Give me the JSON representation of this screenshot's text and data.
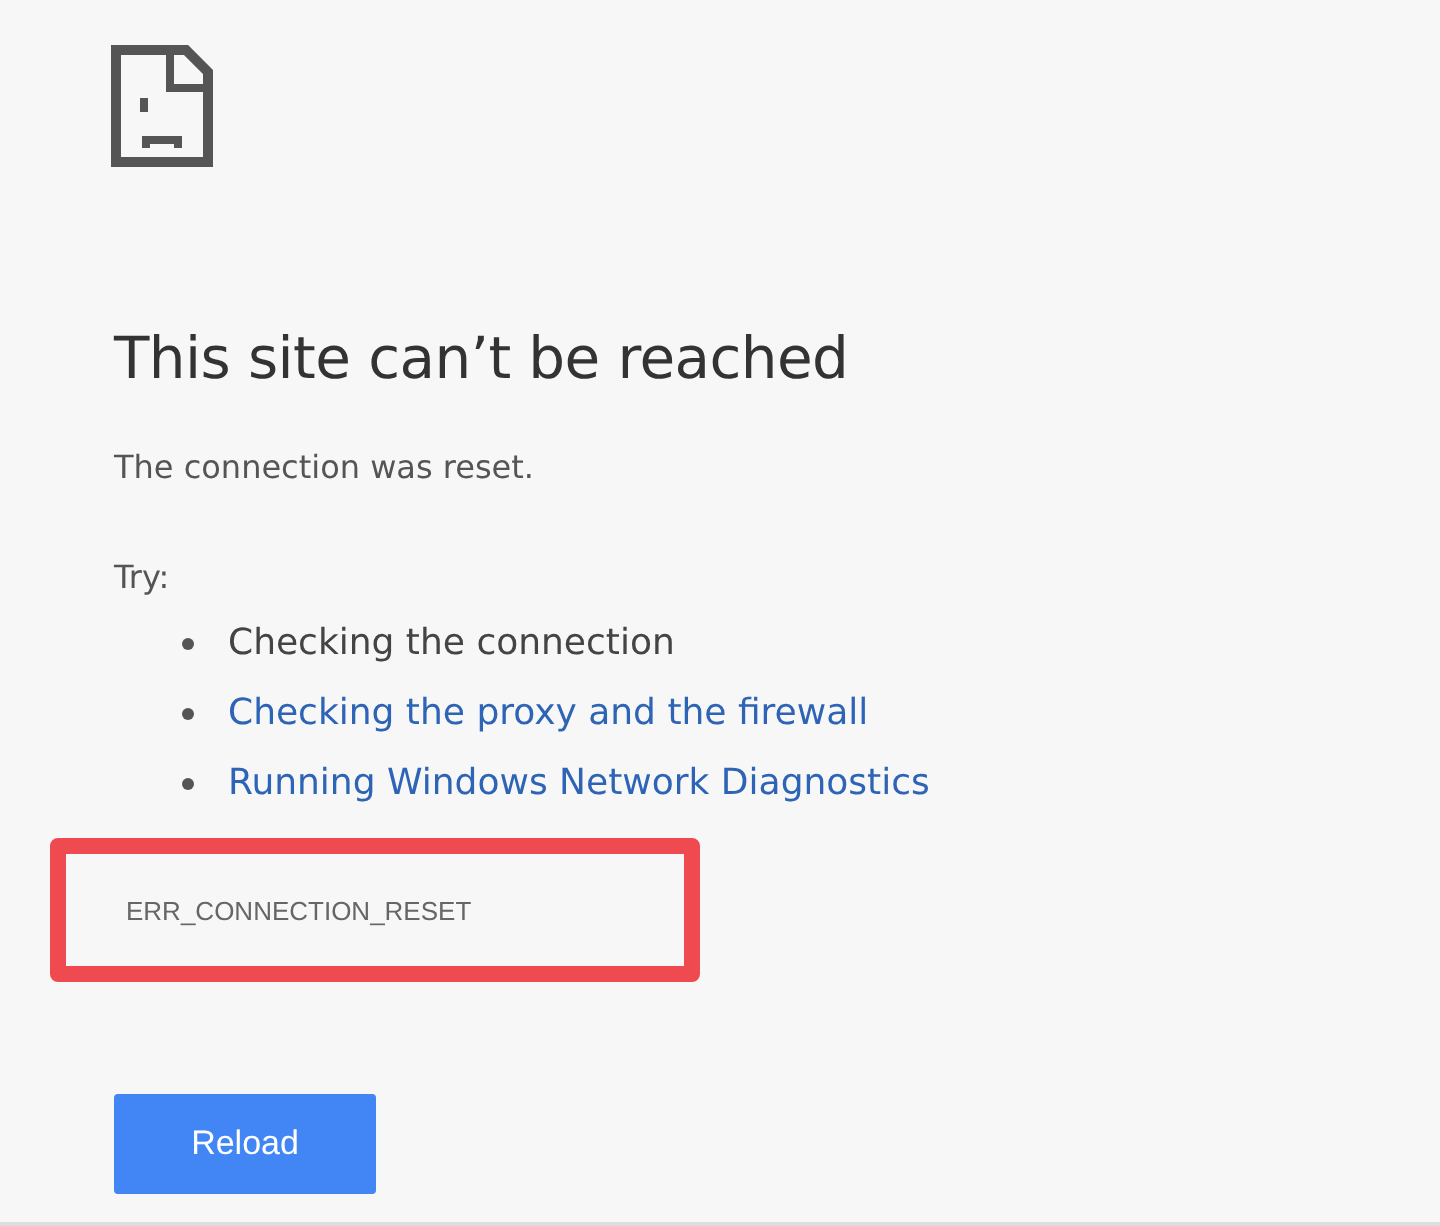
{
  "heading": "This site can’t be reached",
  "message": "The connection was reset.",
  "try_label": "Try:",
  "suggestions": [
    {
      "text": "Checking the connection",
      "kind": "text"
    },
    {
      "text": "Checking the proxy and the firewall",
      "kind": "link"
    },
    {
      "text": "Running Windows Network Diagnostics",
      "kind": "link"
    }
  ],
  "error_code": "ERR_CONNECTION_RESET",
  "highlighted": true,
  "button": "Reload"
}
